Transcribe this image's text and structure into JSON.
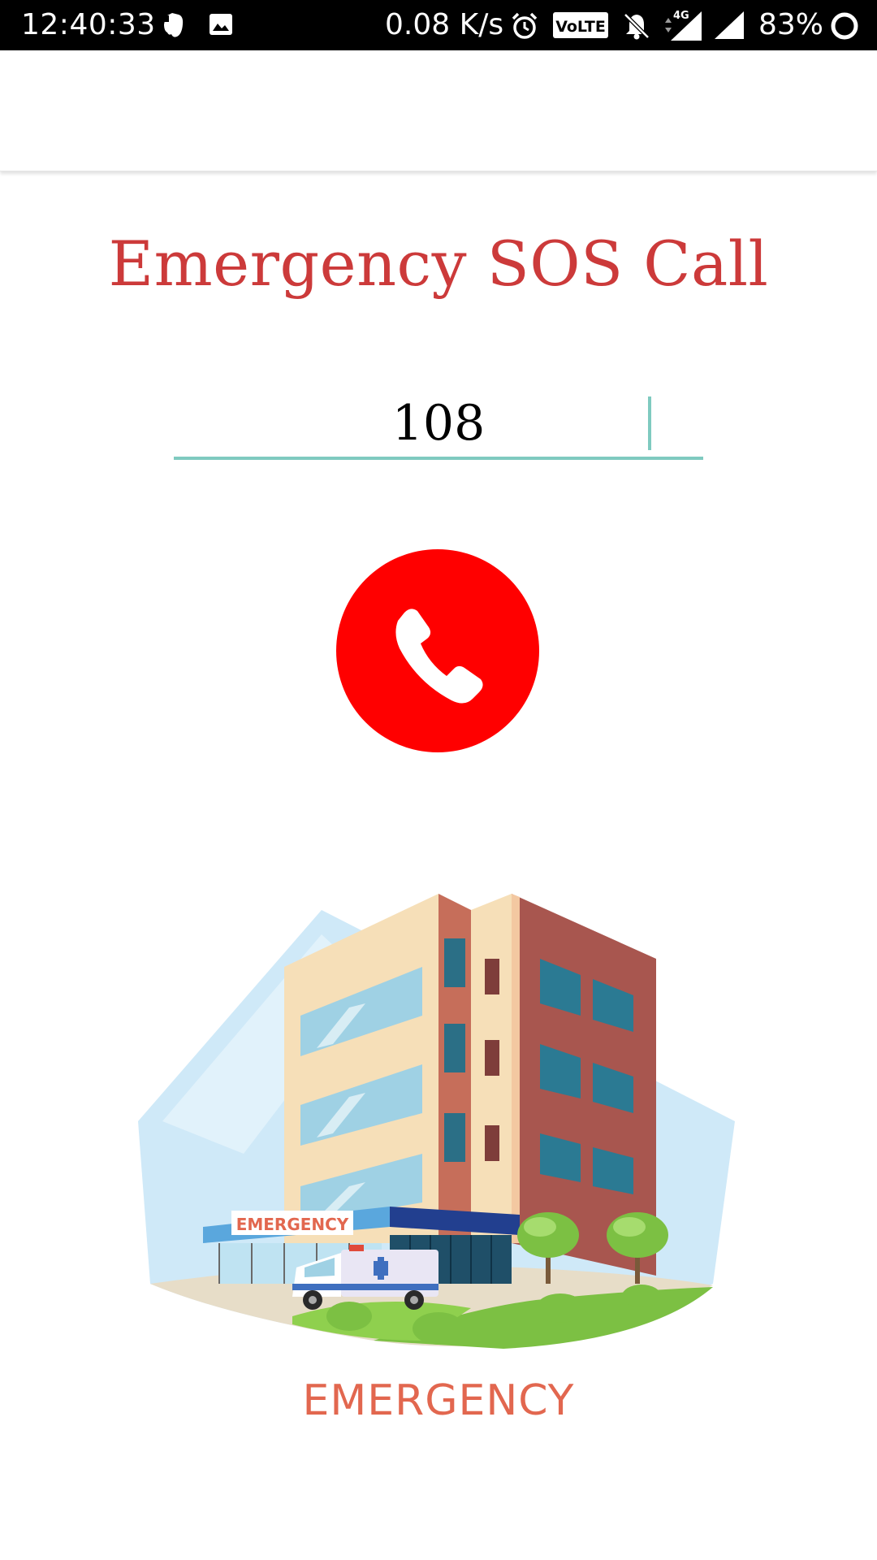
{
  "status_bar": {
    "time": "12:40:33",
    "network_speed": "0.08 K/s",
    "volte": "VoLTE",
    "network_type": "4G",
    "battery": "83%"
  },
  "screen": {
    "title": "Emergency SOS Call",
    "number_field": {
      "value": "108"
    },
    "call_button": {
      "icon": "phone-icon"
    },
    "illustration": {
      "sign_text": "EMERGENCY",
      "caption": "EMERGENCY"
    }
  },
  "colors": {
    "title": "#cc3a3a",
    "accent": "#7fcac0",
    "call_button": "#ff0000",
    "caption": "#e2674f"
  }
}
